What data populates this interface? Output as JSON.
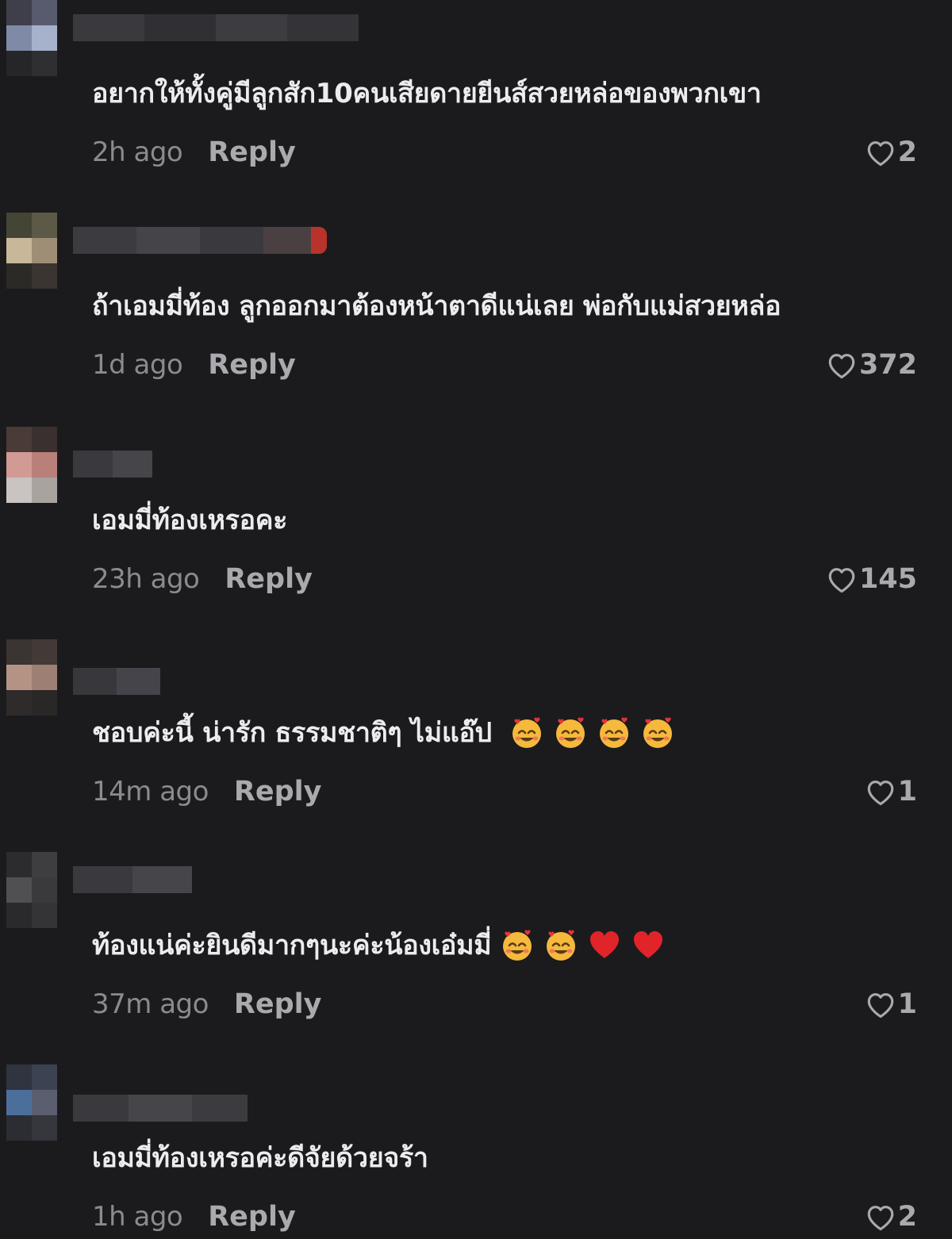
{
  "comments": [
    {
      "text": "อยากให้ทั้งคู่มีลูกสัก10คนเสียดายยีนส์สวยหล่อของพวกเขา",
      "emojis": [],
      "time": "2h ago",
      "reply_label": "Reply",
      "likes": "2"
    },
    {
      "text": "ถ้าเอมมี่ท้อง ลูกออกมาต้องหน้าตาดีแน่เลย พ่อกับแม่สวยหล่อ",
      "emojis": [],
      "time": "1d ago",
      "reply_label": "Reply",
      "likes": "372"
    },
    {
      "text": "เอมมี่ท้องเหรอคะ",
      "emojis": [],
      "time": "23h ago",
      "reply_label": "Reply",
      "likes": "145"
    },
    {
      "text": "ชอบค่ะนี้ น่ารัก ธรรมชาติๆ ไม่แอ๊ป",
      "emojis": [
        "smiling-face-with-hearts-emoji",
        "smiling-face-with-hearts-emoji",
        "smiling-face-with-hearts-emoji",
        "smiling-face-with-hearts-emoji"
      ],
      "time": "14m ago",
      "reply_label": "Reply",
      "likes": "1"
    },
    {
      "text": "ท้องแน่ค่ะยินดีมากๆนะค่ะน้องเอ๋มมี่",
      "emojis": [
        "smiling-face-with-hearts-emoji",
        "smiling-face-with-hearts-emoji",
        "red-heart-emoji",
        "red-heart-emoji"
      ],
      "time": "37m ago",
      "reply_label": "Reply",
      "likes": "1"
    },
    {
      "text": "เอมมี่ท้องเหรอค่ะดีจัยด้วยจร้า",
      "emojis": [],
      "time": "1h ago",
      "reply_label": "Reply",
      "likes": "2"
    }
  ],
  "icons": {
    "like": "heart-outline-icon"
  },
  "colors": {
    "background": "#1b1b1d",
    "text": "#ececee",
    "muted": "#8a8a8f",
    "action": "#a9a9ae"
  }
}
